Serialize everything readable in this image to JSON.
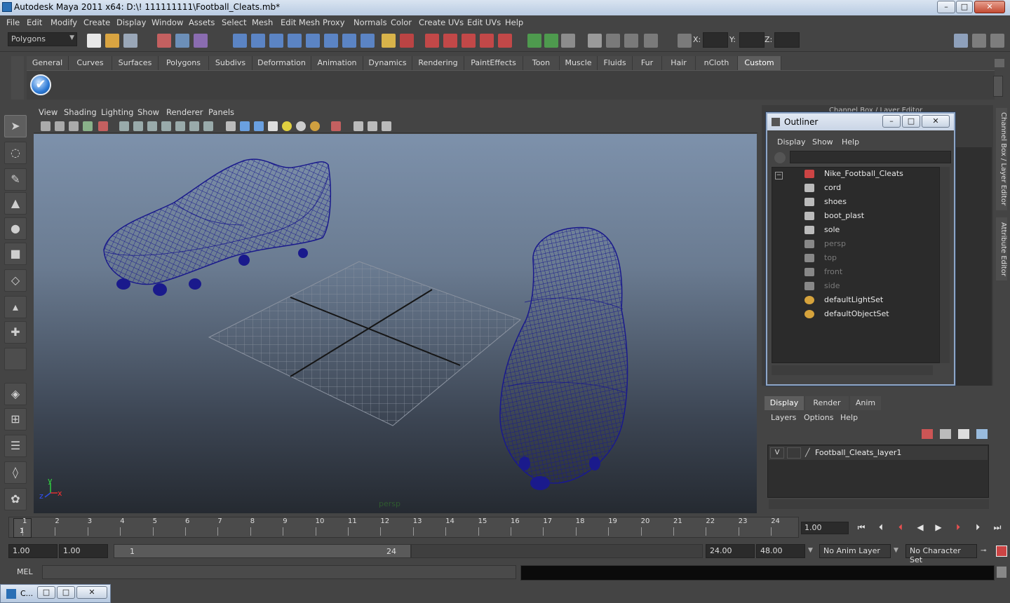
{
  "window": {
    "title": "Autodesk Maya 2011 x64: D:\\! 111111111\\Football_Cleats.mb*",
    "min_label": "–",
    "max_label": "□",
    "close_label": "✕"
  },
  "menubar": [
    "File",
    "Edit",
    "Modify",
    "Create",
    "Display",
    "Window",
    "Assets",
    "Select",
    "Mesh",
    "Edit Mesh",
    "Proxy",
    "Normals",
    "Color",
    "Create UVs",
    "Edit UVs",
    "Help"
  ],
  "statusline": {
    "mode": "Polygons",
    "x_label": "X:",
    "y_label": "Y:",
    "z_label": "Z:"
  },
  "shelf": {
    "tabs": [
      "General",
      "Curves",
      "Surfaces",
      "Polygons",
      "Subdivs",
      "Deformation",
      "Animation",
      "Dynamics",
      "Rendering",
      "PaintEffects",
      "Toon",
      "Muscle",
      "Fluids",
      "Fur",
      "Hair",
      "nCloth",
      "Custom"
    ],
    "active_tab": "Custom",
    "button_icon": "checkmark-icon",
    "button_glyph": "✔"
  },
  "viewport": {
    "menu": [
      "View",
      "Shading",
      "Lighting",
      "Show",
      "Renderer",
      "Panels"
    ],
    "camera": "persp",
    "axis_x": "x",
    "axis_y": "y",
    "axis_z": "z",
    "wire_color": "#1a1a8c"
  },
  "outliner": {
    "title": "Outliner",
    "menu": [
      "Display",
      "Show",
      "Help"
    ],
    "collapse_glyph": "−",
    "items": [
      {
        "label": "Nike_Football_Cleats",
        "level": 0,
        "dim": false,
        "icon": "group-icon"
      },
      {
        "label": "cord",
        "level": 1,
        "dim": false,
        "icon": "mesh-icon"
      },
      {
        "label": "shoes",
        "level": 1,
        "dim": false,
        "icon": "mesh-icon"
      },
      {
        "label": "boot_plast",
        "level": 1,
        "dim": false,
        "icon": "mesh-icon"
      },
      {
        "label": "sole",
        "level": 1,
        "dim": false,
        "icon": "mesh-icon"
      },
      {
        "label": "persp",
        "level": 0,
        "dim": true,
        "icon": "camera-icon"
      },
      {
        "label": "top",
        "level": 0,
        "dim": true,
        "icon": "camera-icon"
      },
      {
        "label": "front",
        "level": 0,
        "dim": true,
        "icon": "camera-icon"
      },
      {
        "label": "side",
        "level": 0,
        "dim": true,
        "icon": "camera-icon"
      },
      {
        "label": "defaultLightSet",
        "level": 0,
        "dim": false,
        "icon": "set-icon"
      },
      {
        "label": "defaultObjectSet",
        "level": 0,
        "dim": false,
        "icon": "set-icon"
      }
    ]
  },
  "channelbox": {
    "title": "Channel Box / Layer Editor",
    "side_tabs": [
      "Channel Box / Layer Editor",
      "Attribute Editor"
    ]
  },
  "layers": {
    "tabs": [
      "Display",
      "Render",
      "Anim"
    ],
    "active_tab": "Display",
    "menu": [
      "Layers",
      "Options",
      "Help"
    ],
    "layer_name": "Football_Cleats_layer1",
    "visible_flag": "V"
  },
  "timeline": {
    "ticks": [
      "1",
      "2",
      "3",
      "4",
      "5",
      "6",
      "7",
      "8",
      "9",
      "10",
      "11",
      "12",
      "13",
      "14",
      "15",
      "16",
      "17",
      "18",
      "19",
      "20",
      "21",
      "22",
      "23",
      "24"
    ],
    "current_frame": "1",
    "current_time": "1.00"
  },
  "range": {
    "start": "1.00",
    "min": "1.00",
    "range_start": "1",
    "range_end": "24",
    "end": "24.00",
    "max": "48.00",
    "anim_layer": "No Anim Layer",
    "character_set": "No Character Set"
  },
  "commandline": {
    "label": "MEL"
  },
  "taskbar": {
    "label": "C..."
  }
}
